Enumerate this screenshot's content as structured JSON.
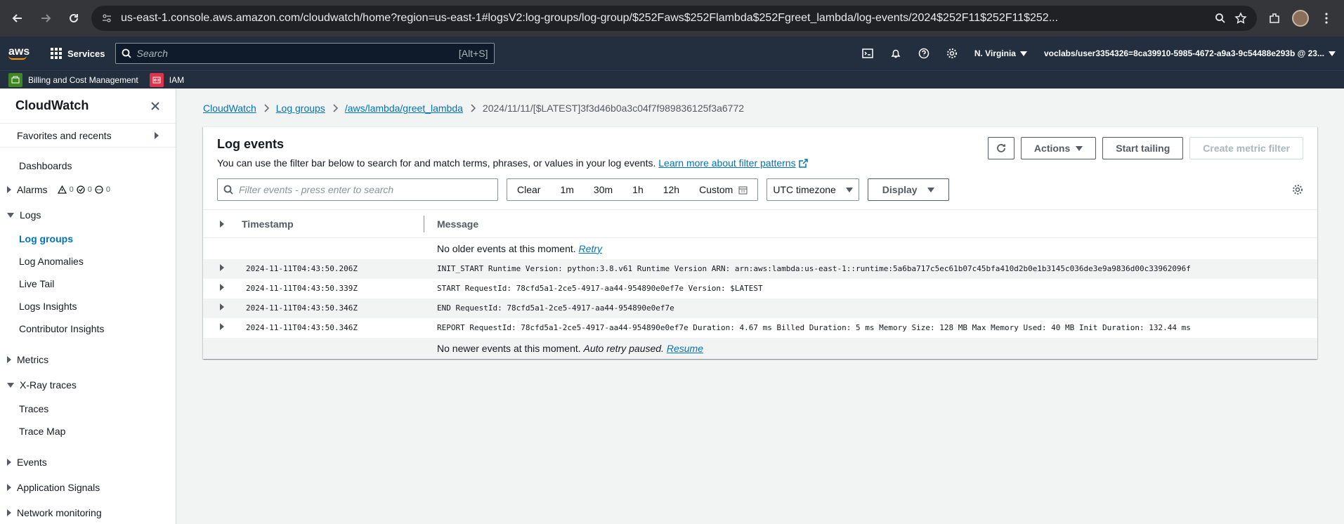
{
  "browser": {
    "url": "us-east-1.console.aws.amazon.com/cloudwatch/home?region=us-east-1#logsV2:log-groups/log-group/$252Faws$252Flambda$252Fgreet_lambda/log-events/2024$252F11$252F11$252..."
  },
  "awsnav": {
    "logo": "aws",
    "services_label": "Services",
    "search_placeholder": "Search",
    "search_shortcut": "[Alt+S]",
    "region": "N. Virginia",
    "account": "voclabs/user3354326=8ca39910-5985-4672-a9a3-9c54488e293b @ 23..."
  },
  "favbar": {
    "items": [
      {
        "label": "Billing and Cost Management",
        "color": "#3f8624"
      },
      {
        "label": "IAM",
        "color": "#dd344c"
      }
    ]
  },
  "sidenav": {
    "title": "CloudWatch",
    "favorites": "Favorites and recents",
    "dashboards": "Dashboards",
    "alarms": "Alarms",
    "alarm_counts": [
      "0",
      "0",
      "0"
    ],
    "logs": "Logs",
    "log_items": [
      "Log groups",
      "Log Anomalies",
      "Live Tail",
      "Logs Insights",
      "Contributor Insights"
    ],
    "metrics": "Metrics",
    "xray": "X-Ray traces",
    "xray_items": [
      "Traces",
      "Trace Map"
    ],
    "events": "Events",
    "app_signals": "Application Signals",
    "network": "Network monitoring"
  },
  "breadcrumb": {
    "items": [
      "CloudWatch",
      "Log groups",
      "/aws/lambda/greet_lambda"
    ],
    "current": "2024/11/11/[$LATEST]3f3d46b0a3c04f7f989836125f3a6772"
  },
  "panel": {
    "title": "Log events",
    "desc": "You can use the filter bar below to search for and match terms, phrases, or values in your log events.",
    "learn_more": "Learn more about filter patterns",
    "actions_label": "Actions",
    "start_tailing": "Start tailing",
    "create_metric": "Create metric filter",
    "filter_placeholder": "Filter events - press enter to search",
    "time_buttons": [
      "Clear",
      "1m",
      "30m",
      "1h",
      "12h"
    ],
    "custom": "Custom",
    "timezone": "UTC timezone",
    "display": "Display",
    "col_timestamp": "Timestamp",
    "col_message": "Message",
    "no_older": "No older events at this moment.",
    "retry": "Retry",
    "no_newer": "No newer events at this moment.",
    "auto_retry": "Auto retry paused.",
    "resume": "Resume"
  },
  "events": [
    {
      "ts": "2024-11-11T04:43:50.206Z",
      "msg": "INIT_START Runtime Version: python:3.8.v61 Runtime Version ARN: arn:aws:lambda:us-east-1::runtime:5a6ba717c5ec61b07c45bfa410d2b0e1b3145c036de3e9a9836d00c33962096f"
    },
    {
      "ts": "2024-11-11T04:43:50.339Z",
      "msg": "START RequestId: 78cfd5a1-2ce5-4917-aa44-954890e0ef7e Version: $LATEST"
    },
    {
      "ts": "2024-11-11T04:43:50.346Z",
      "msg": "END RequestId: 78cfd5a1-2ce5-4917-aa44-954890e0ef7e"
    },
    {
      "ts": "2024-11-11T04:43:50.346Z",
      "msg": "REPORT RequestId: 78cfd5a1-2ce5-4917-aa44-954890e0ef7e Duration: 4.67 ms Billed Duration: 5 ms Memory Size: 128 MB Max Memory Used: 40 MB Init Duration: 132.44 ms"
    }
  ]
}
